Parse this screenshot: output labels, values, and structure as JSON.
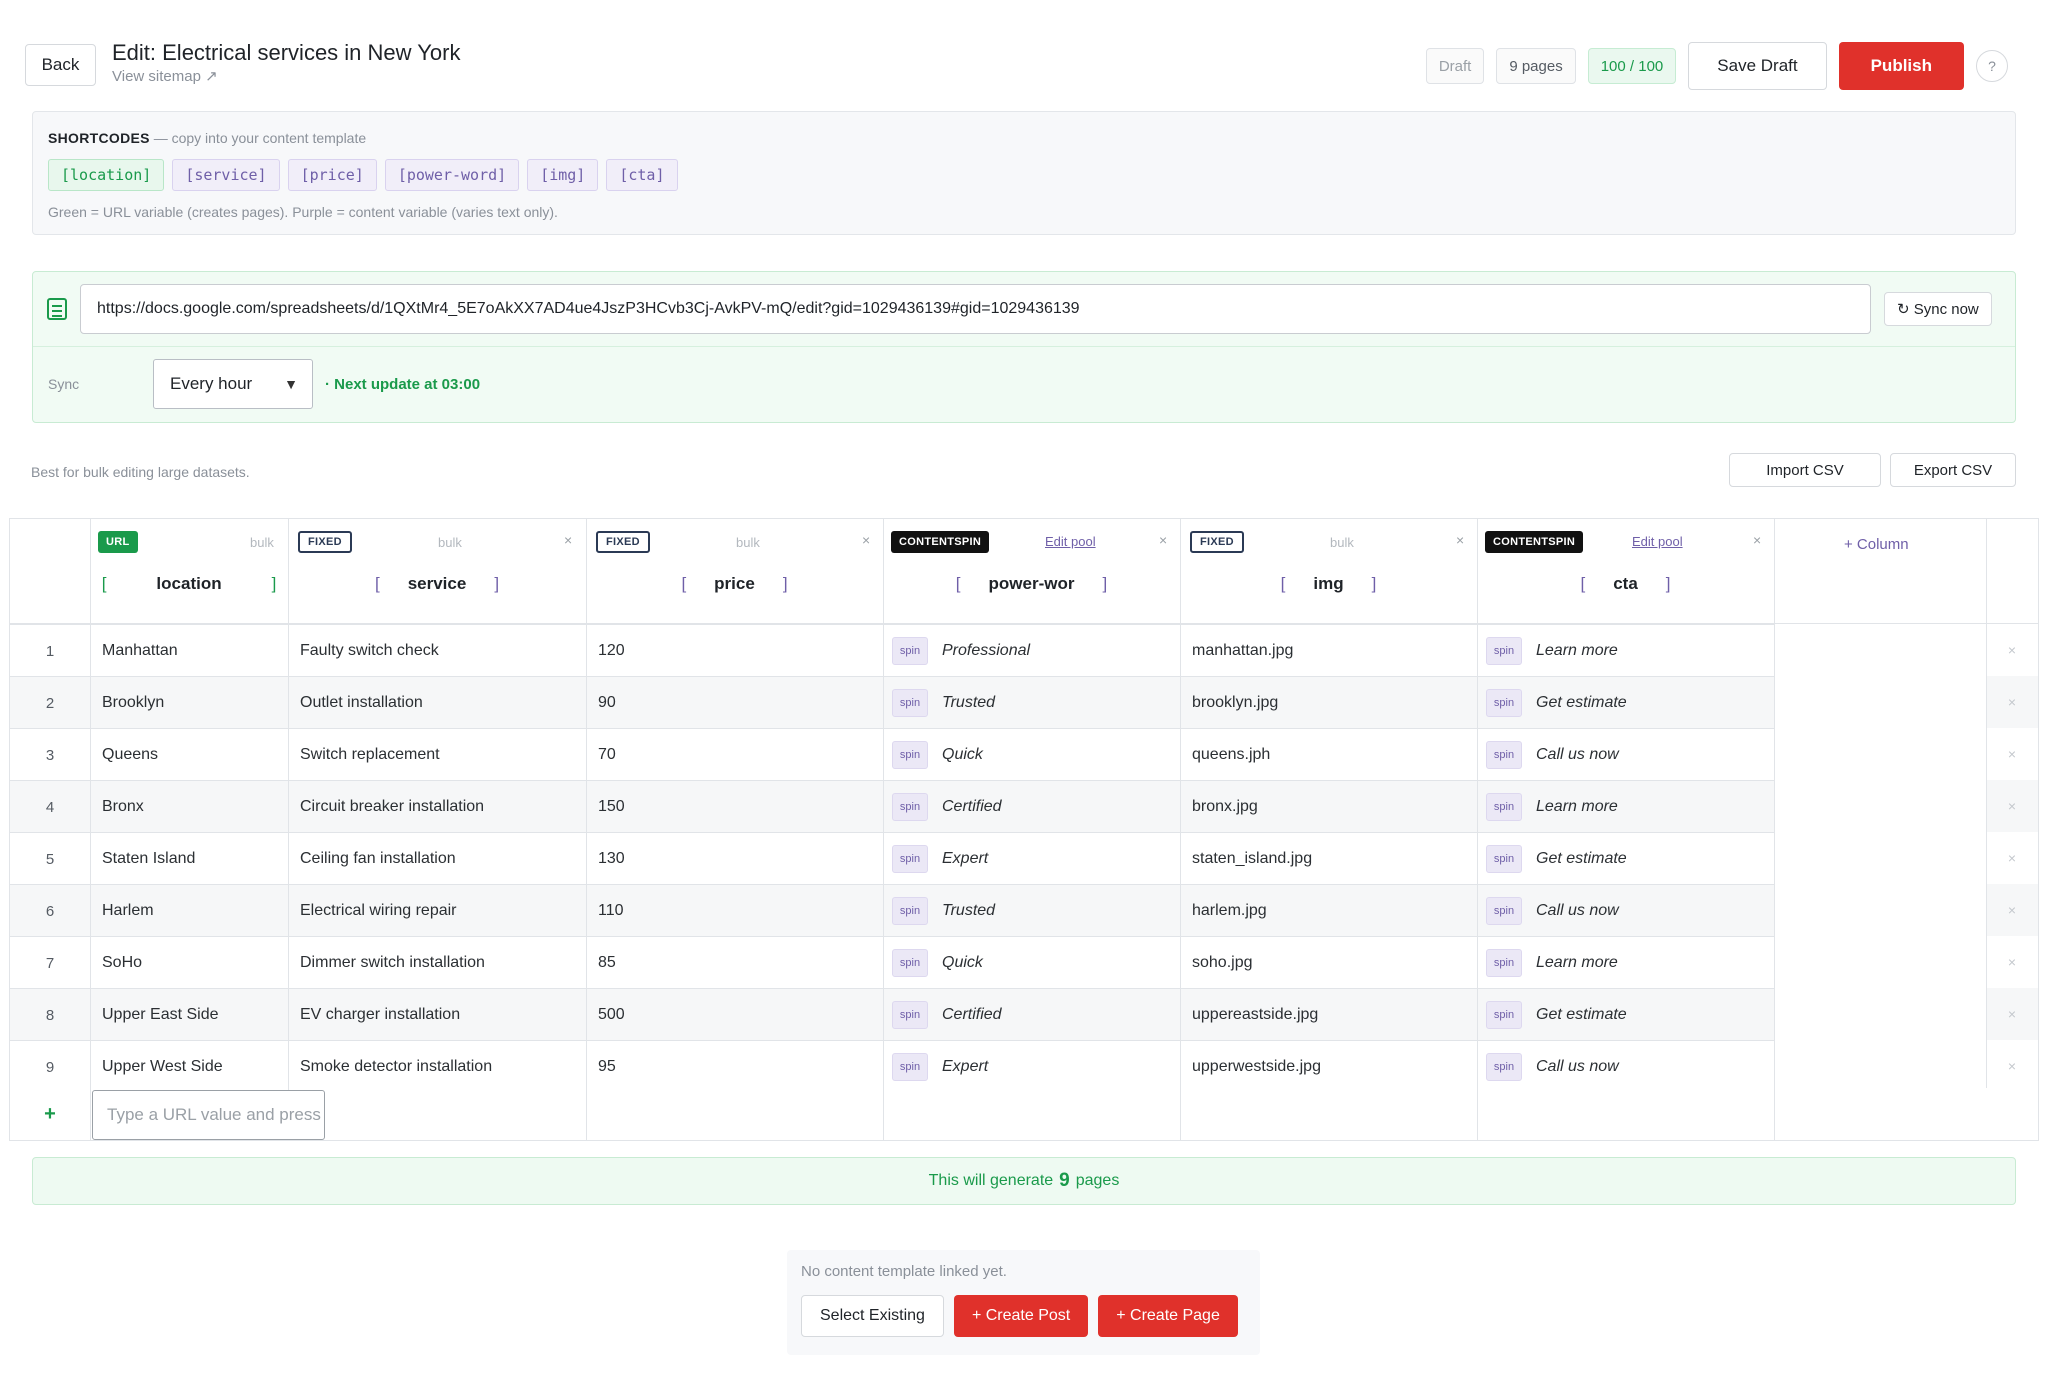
{
  "header": {
    "back_label": "Back",
    "title": "Edit: Electrical services in New York",
    "view_sitemap": "View sitemap ↗",
    "status": "Draft",
    "pages": "9 pages",
    "score": "100 / 100",
    "save_draft": "Save Draft",
    "publish": "Publish",
    "help": "?"
  },
  "shortcodes": {
    "title": "SHORTCODES",
    "subtitle": "— copy into your content template",
    "tags": [
      {
        "label": "[location]",
        "kind": "green"
      },
      {
        "label": "[service]",
        "kind": "purple"
      },
      {
        "label": "[price]",
        "kind": "purple"
      },
      {
        "label": "[power-word]",
        "kind": "purple"
      },
      {
        "label": "[img]",
        "kind": "purple"
      },
      {
        "label": "[cta]",
        "kind": "purple"
      }
    ],
    "note": "Green = URL variable (creates pages). Purple = content variable (varies text only)."
  },
  "sheet": {
    "url": "https://docs.google.com/spreadsheets/d/1QXtMr4_5E7oAkXX7AD4ue4JszP3HCvb3Cj-AvkPV-mQ/edit?gid=1029436139#gid=1029436139",
    "sync_now": "↻ Sync now",
    "sync_label": "Sync",
    "sync_value": "Every hour",
    "next_update": "· Next update at 03:00"
  },
  "bulk": {
    "note": "Best for bulk editing large datasets.",
    "import": "Import CSV",
    "export": "Export CSV"
  },
  "table": {
    "columns": [
      {
        "type": "URL",
        "name": "location",
        "action": "bulk"
      },
      {
        "type": "FIXED",
        "name": "service",
        "action": "bulk"
      },
      {
        "type": "FIXED",
        "name": "price",
        "action": "bulk"
      },
      {
        "type": "CONTENTSPIN",
        "name": "power-wor",
        "action": "Edit pool"
      },
      {
        "type": "FIXED",
        "name": "img",
        "action": "bulk"
      },
      {
        "type": "CONTENTSPIN",
        "name": "cta",
        "action": "Edit pool"
      }
    ],
    "add_column": "+  Column",
    "spin_label": "spin",
    "remove": "×",
    "rows": [
      {
        "n": "1",
        "location": "Manhattan",
        "service": "Faulty switch check",
        "price": "120",
        "power": "Professional",
        "img": "manhattan.jpg",
        "cta": "Learn more"
      },
      {
        "n": "2",
        "location": "Brooklyn",
        "service": "Outlet installation",
        "price": "90",
        "power": "Trusted",
        "img": "brooklyn.jpg",
        "cta": "Get estimate"
      },
      {
        "n": "3",
        "location": "Queens",
        "service": "Switch replacement",
        "price": "70",
        "power": "Quick",
        "img": "queens.jph",
        "cta": "Call us now"
      },
      {
        "n": "4",
        "location": "Bronx",
        "service": "Circuit breaker installation",
        "price": "150",
        "power": "Certified",
        "img": "bronx.jpg",
        "cta": "Learn more"
      },
      {
        "n": "5",
        "location": "Staten Island",
        "service": "Ceiling fan installation",
        "price": "130",
        "power": "Expert",
        "img": "staten_island.jpg",
        "cta": "Get estimate"
      },
      {
        "n": "6",
        "location": "Harlem",
        "service": "Electrical wiring repair",
        "price": "110",
        "power": "Trusted",
        "img": "harlem.jpg",
        "cta": "Call us now"
      },
      {
        "n": "7",
        "location": "SoHo",
        "service": "Dimmer switch installation",
        "price": "85",
        "power": "Quick",
        "img": "soho.jpg",
        "cta": "Learn more"
      },
      {
        "n": "8",
        "location": "Upper East Side",
        "service": "EV charger installation",
        "price": "500",
        "power": "Certified",
        "img": "uppereastside.jpg",
        "cta": "Get estimate"
      },
      {
        "n": "9",
        "location": "Upper West Side",
        "service": "Smoke detector installation",
        "price": "95",
        "power": "Expert",
        "img": "upperwestside.jpg",
        "cta": "Call us now"
      }
    ],
    "add_row_plus": "+",
    "add_row_placeholder": "Type a URL value and press Enter"
  },
  "generate": {
    "prefix": "This will generate",
    "count": "9",
    "suffix": "pages"
  },
  "template": {
    "note": "No content template linked yet.",
    "select_existing": "Select Existing",
    "create_post": "+ Create Post",
    "create_page": "+ Create Page"
  },
  "colors": {
    "accent_green": "#1a9a4b",
    "accent_red": "#e0312b",
    "accent_purple": "#6f5fa8"
  }
}
